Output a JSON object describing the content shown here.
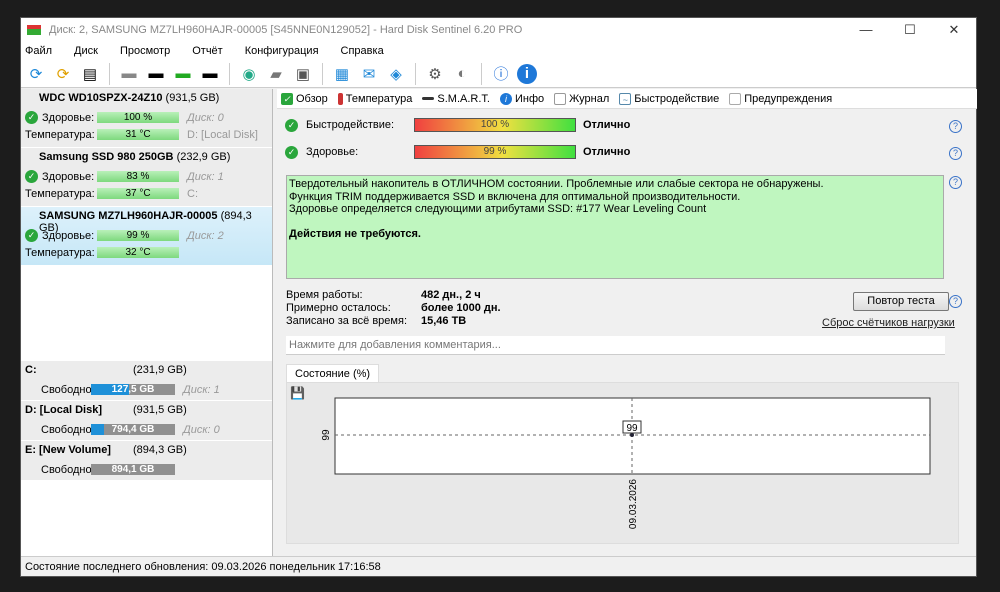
{
  "window": {
    "title": "Диск: 2, SAMSUNG MZ7LH960HAJR-00005 [S45NNE0N129052]  -  Hard Disk Sentinel 6.20 PRO"
  },
  "menu": [
    "Файл",
    "Диск",
    "Просмотр",
    "Отчёт",
    "Конфигурация",
    "Справка"
  ],
  "disks": [
    {
      "name": "WDC WD10SPZX-24Z10",
      "size": "(931,5 GB)",
      "health_label": "Здоровье:",
      "health": "100 %",
      "temp_label": "Температура:",
      "temp": "31 °C",
      "disk": "Диск: 0",
      "volume": "D: [Local Disk]"
    },
    {
      "name": "Samsung SSD 980 250GB",
      "size": "(232,9 GB)",
      "health_label": "Здоровье:",
      "health": "83 %",
      "temp_label": "Температура:",
      "temp": "37 °C",
      "disk": "Диск: 1",
      "volume": "C:"
    },
    {
      "name": "SAMSUNG MZ7LH960HAJR-00005",
      "size": "(894,3 GB)",
      "health_label": "Здоровье:",
      "health": "99 %",
      "temp_label": "Температура:",
      "temp": "32 °C",
      "disk": "Диск: 2",
      "volume": ""
    }
  ],
  "volumes": [
    {
      "name": "C:",
      "size": "(231,9 GB)",
      "free_label": "Свободно",
      "free": "127,5 GB",
      "used_fraction": 0.45,
      "disk": "Диск: 1"
    },
    {
      "name": "D: [Local Disk]",
      "size": "(931,5 GB)",
      "free_label": "Свободно",
      "free": "794,4 GB",
      "used_fraction": 0.15,
      "disk": "Диск: 0"
    },
    {
      "name": "E: [New Volume]",
      "size": "(894,3 GB)",
      "free_label": "Свободно",
      "free": "894,1 GB",
      "used_fraction": 0.0,
      "disk": ""
    }
  ],
  "tabs": [
    "Обзор",
    "Температура",
    "S.M.A.R.T.",
    "Инфо",
    "Журнал",
    "Быстродействие",
    "Предупреждения"
  ],
  "overview": {
    "perf_label": "Быстродействие:",
    "perf": "100 %",
    "perf_status": "Отлично",
    "health_label": "Здоровье:",
    "health": "99 %",
    "health_status": "Отлично",
    "message": [
      "Твердотельный накопитель в ОТЛИЧНОМ состоянии. Проблемные или слабые сектора не обнаружены.",
      "Функция TRIM поддерживается SSD и включена для оптимальной производительности.",
      "Здоровье определяется следующими атрибутами SSD: #177 Wear Leveling Count"
    ],
    "action": "Действия не требуются.",
    "uptime_label": "Время работы:",
    "uptime": "482 дн., 2 ч",
    "remaining_label": "Примерно осталось:",
    "remaining": "более 1000 дн.",
    "written_label": "Записано за всё время:",
    "written": "15,46 TB",
    "retest": "Повтор теста",
    "reset": "Сброс счётчиков нагрузки",
    "comment_placeholder": "Нажмите для добавления комментария...",
    "chart_tab": "Состояние (%)"
  },
  "chart_data": {
    "type": "line",
    "x": [
      "09.03.2026"
    ],
    "values": [
      99
    ],
    "ytick": "99",
    "point_label": "99"
  },
  "status": "Состояние последнего обновления: 09.03.2026 понедельник 17:16:58"
}
